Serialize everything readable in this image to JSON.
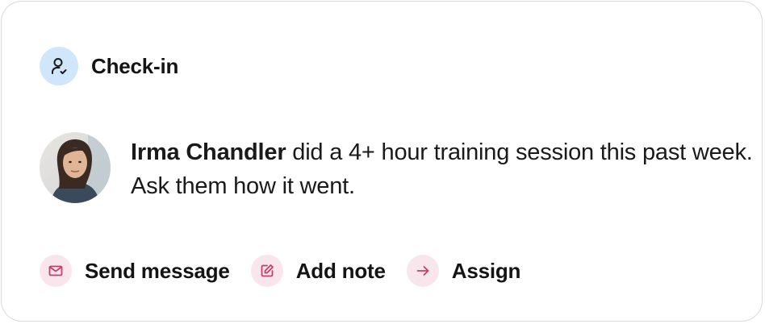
{
  "card": {
    "title": "Check-in",
    "person_name": "Irma Chandler",
    "message": " did a 4+ hour training session this past week. Ask them how it went."
  },
  "actions": [
    {
      "label": "Send message",
      "icon": "mail-icon"
    },
    {
      "label": "Add note",
      "icon": "edit-note-icon"
    },
    {
      "label": "Assign",
      "icon": "arrow-right-icon"
    }
  ],
  "colors": {
    "header_icon_bg": "#cfe6fb",
    "action_icon_bg": "#f9e6ec",
    "action_icon_fg": "#c2416b",
    "text": "#141414"
  }
}
